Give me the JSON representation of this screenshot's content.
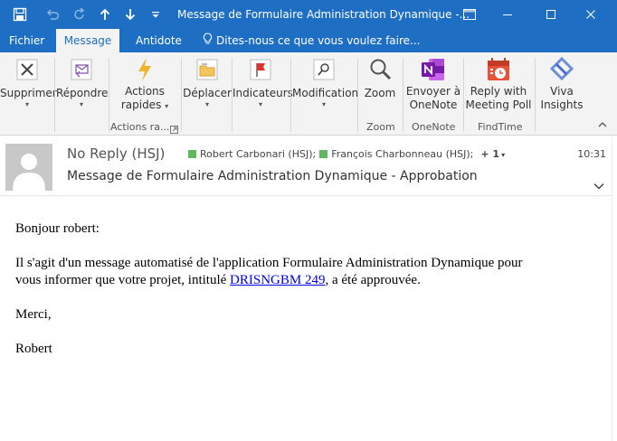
{
  "window": {
    "title": "Message de Formulaire Administration Dynamique -..."
  },
  "tabs": [
    {
      "label": "Fichier"
    },
    {
      "label": "Message"
    },
    {
      "label": "Antidote"
    }
  ],
  "tell_me": "Dites-nous ce que vous voulez faire...",
  "ribbon": {
    "supprimer": "Supprimer",
    "repondre": "Répondre",
    "actions_rapides_1": "Actions",
    "actions_rapides_2": "rapides",
    "actions_group": "Actions ra...",
    "deplacer": "Déplacer",
    "indicateurs": "Indicateurs",
    "modification": "Modification",
    "zoom": "Zoom",
    "zoom_group": "Zoom",
    "envoyer_1": "Envoyer à",
    "envoyer_2": "OneNote",
    "onenote_group": "OneNote",
    "reply_meeting_1": "Reply with",
    "reply_meeting_2": "Meeting Poll",
    "findtime_group": "FindTime",
    "viva_1": "Viva",
    "viva_2": "Insights"
  },
  "message": {
    "sender": "No Reply (HSJ)",
    "recipients": [
      "Robert Carbonari (HSJ);",
      "François Charbonneau (HSJ);"
    ],
    "more_count": "+ 1",
    "time": "10:31",
    "subject": "Message de Formulaire Administration Dynamique - Approbation",
    "greeting": "Bonjour robert:",
    "line1": "Il s'agit d'un message automatisé de l'application Formulaire Administration Dynamique pour",
    "line2_before": "vous informer que votre projet, intitulé ",
    "project_link": "DRISNGBM 249",
    "line2_after": ", a été approuvée.",
    "merci": "Merci,",
    "signature": "Robert"
  },
  "colors": {
    "titlebar": "#1e6fc4",
    "ribbon": "#f3f3f3",
    "link": "#0000ee",
    "status_green": "#5fb85f"
  }
}
